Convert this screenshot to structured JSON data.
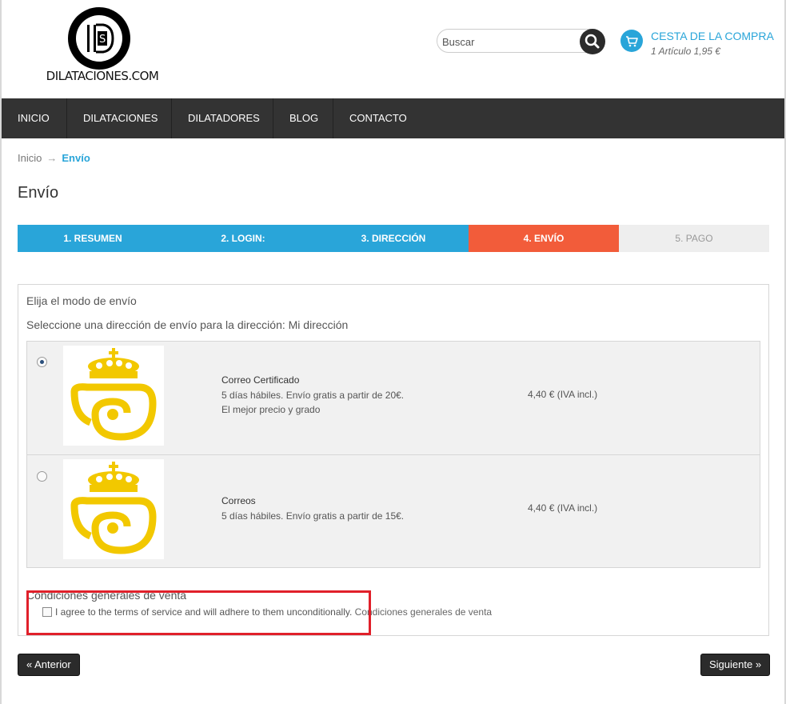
{
  "header": {
    "logo_text": "DILATACIONES.COM",
    "search_placeholder": "Buscar",
    "cart_title": "CESTA DE LA COMPRA",
    "cart_summary": "1 Artículo 1,95 €"
  },
  "nav": {
    "items": [
      {
        "label": "INICIO",
        "has_dropdown": false
      },
      {
        "label": "DILATACIONES",
        "has_dropdown": true
      },
      {
        "label": "DILATADORES",
        "has_dropdown": true
      },
      {
        "label": "BLOG",
        "has_dropdown": false
      },
      {
        "label": "CONTACTO",
        "has_dropdown": false
      }
    ]
  },
  "breadcrumb": {
    "home": "Inicio",
    "arrow": "→",
    "current": "Envío"
  },
  "page_title": "Envío",
  "steps": [
    {
      "label": "1. RESUMEN",
      "state": "done"
    },
    {
      "label": "2. LOGIN:",
      "state": "done"
    },
    {
      "label": "3. DIRECCIÓN",
      "state": "done"
    },
    {
      "label": "4. ENVÍO",
      "state": "current"
    },
    {
      "label": "5. PAGO",
      "state": "todo"
    }
  ],
  "shipping": {
    "heading": "Elija el modo de envío",
    "subheading": "Seleccione una dirección de envío para la dirección: Mi dirección",
    "carriers": [
      {
        "name": "Correo Certificado",
        "desc_line1": "5 días hábiles. Envío gratis a partir de 20€.",
        "desc_line2": "El mejor precio y grado",
        "price": "4,40 € (IVA incl.)",
        "selected": true
      },
      {
        "name": "Correos",
        "desc_line1": "5 días hábiles. Envío gratis a partir de 15€.",
        "desc_line2": "",
        "price": "4,40 € (IVA incl.)",
        "selected": false
      }
    ]
  },
  "terms": {
    "heading": "Condiciones generales de venta",
    "agree_text": "I agree to the terms of service and will adhere to them unconditionally.",
    "link_text": "Condiciones generales de venta"
  },
  "buttons": {
    "prev": "« Anterior",
    "next": "Siguiente »"
  },
  "colors": {
    "accent": "#29a5d9",
    "current_step": "#f25c3a",
    "todo_step": "#eeeeee",
    "nav_bg": "#333333",
    "highlight": "#e0202a",
    "correos_yellow": "#f2c800"
  }
}
